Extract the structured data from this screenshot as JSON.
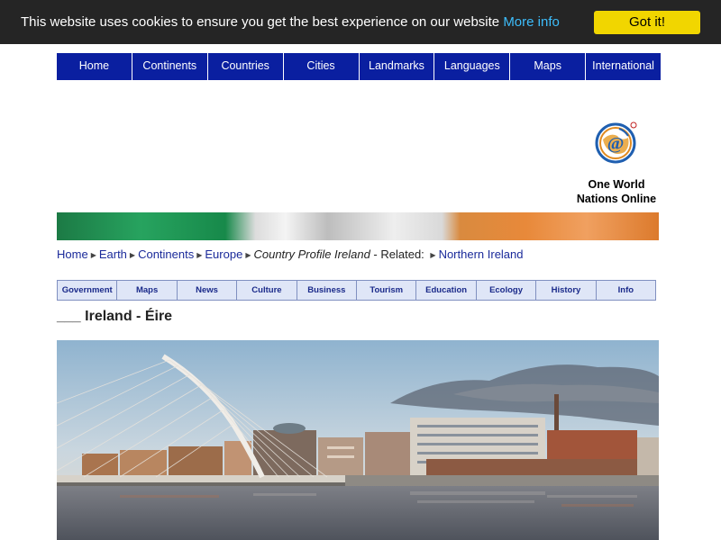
{
  "cookie": {
    "message": "This website uses cookies to ensure you get the best experience on our website",
    "more_info": "More info",
    "accept": "Got it!"
  },
  "nav": {
    "items": [
      "Home",
      "Continents",
      "Countries",
      "Cities",
      "Landmarks",
      "Languages",
      "Maps",
      "International"
    ]
  },
  "brand": {
    "line1": "One World",
    "line2": "Nations Online"
  },
  "breadcrumb": {
    "items": [
      "Home",
      "Earth",
      "Continents",
      "Europe"
    ],
    "current": "Country Profile Ireland",
    "related_label": " - Related: ",
    "related": "Northern Ireland"
  },
  "subnav": {
    "items": [
      "Government",
      "Maps",
      "News",
      "Culture",
      "Business",
      "Tourism",
      "Education",
      "Ecology",
      "History",
      "Info"
    ]
  },
  "page": {
    "title": "___ Ireland - Éire"
  },
  "colors": {
    "nav_bg": "#0a1fa0",
    "cookie_bg": "#252525",
    "cookie_button": "#f1d600",
    "link": "#1a2a9a"
  }
}
